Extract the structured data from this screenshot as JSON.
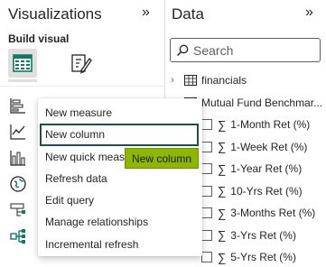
{
  "visualizations": {
    "title": "Visualizations",
    "collapse_glyph": "»",
    "build_label": "Build visual",
    "build_icons": [
      "table-grid-icon",
      "format-paintbrush-icon"
    ],
    "viz_icons": [
      "stacked-bar-icon",
      "line-chart-icon",
      "column-chart-icon",
      "globe-map-icon",
      "decomposition-tree-icon",
      "key-influencers-icon"
    ]
  },
  "data_pane": {
    "title": "Data",
    "collapse_glyph": "»",
    "search_placeholder": "Search",
    "tables": [
      {
        "label": "financials",
        "expanded": false
      }
    ],
    "expanded_table_label": "Mutual Fund Benchmar...",
    "fields": [
      "1-Month Ret (%)",
      "1-Week Ret (%)",
      "1-Year Ret (%)",
      "10-Yrs Ret (%)",
      "3-Months Ret (%)",
      "3-Yrs Ret (%)",
      "5-Yrs Ret (%)"
    ],
    "sigma_glyph": "∑"
  },
  "context_menu": {
    "items": [
      "New measure",
      "New column",
      "New quick measure",
      "Refresh data",
      "Edit query",
      "Manage relationships",
      "Incremental refresh"
    ],
    "focused_index": 1
  },
  "tooltip": {
    "text": "New column"
  },
  "colors": {
    "focus_outline": "#1f4e4a",
    "tooltip_bg": "#8db600",
    "text": "#252423"
  }
}
